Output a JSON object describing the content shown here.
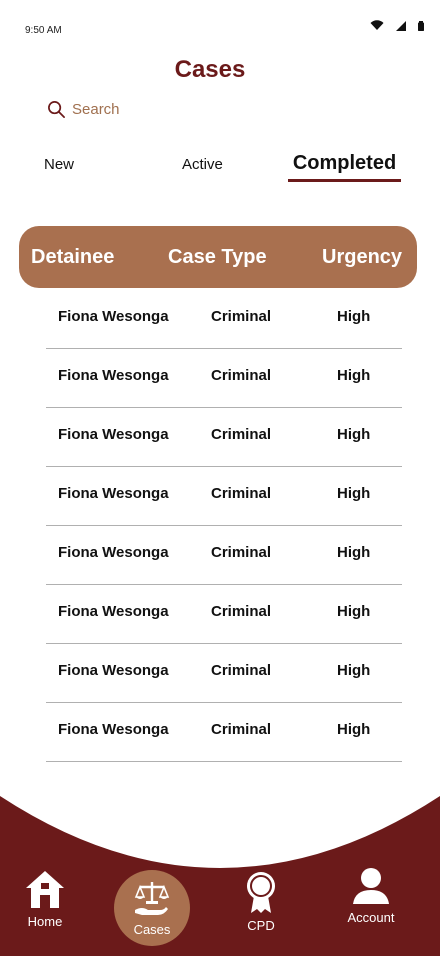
{
  "status_bar": {
    "time": "9:50 AM"
  },
  "page": {
    "title": "Cases"
  },
  "search": {
    "placeholder": "Search"
  },
  "tabs": [
    {
      "label": "New"
    },
    {
      "label": "Active"
    },
    {
      "label": "Completed",
      "selected": true
    }
  ],
  "table": {
    "headers": {
      "detainee": "Detainee",
      "case_type": "Case Type",
      "urgency": "Urgency"
    },
    "rows": [
      {
        "detainee": "Fiona Wesonga",
        "case_type": "Criminal",
        "urgency": "High"
      },
      {
        "detainee": "Fiona Wesonga",
        "case_type": "Criminal",
        "urgency": "High"
      },
      {
        "detainee": "Fiona Wesonga",
        "case_type": "Criminal",
        "urgency": "High"
      },
      {
        "detainee": "Fiona Wesonga",
        "case_type": "Criminal",
        "urgency": "High"
      },
      {
        "detainee": "Fiona Wesonga",
        "case_type": "Criminal",
        "urgency": "High"
      },
      {
        "detainee": "Fiona Wesonga",
        "case_type": "Criminal",
        "urgency": "High"
      },
      {
        "detainee": "Fiona Wesonga",
        "case_type": "Criminal",
        "urgency": "High"
      },
      {
        "detainee": "Fiona Wesonga",
        "case_type": "Criminal",
        "urgency": "High"
      }
    ]
  },
  "bottom_nav": {
    "home": "Home",
    "cases": "Cases",
    "cpd": "CPD",
    "account": "Account"
  },
  "icons": {
    "search": "search-icon",
    "wifi": "wifi-icon",
    "signal": "signal-icon",
    "battery": "battery-icon",
    "home": "home-icon",
    "cases": "scales-of-justice-icon",
    "cpd": "award-ribbon-icon",
    "account": "user-icon"
  },
  "colors": {
    "brand_dark": "#6b1a1a",
    "brand_accent": "#a9704f",
    "background": "#ffffff"
  }
}
